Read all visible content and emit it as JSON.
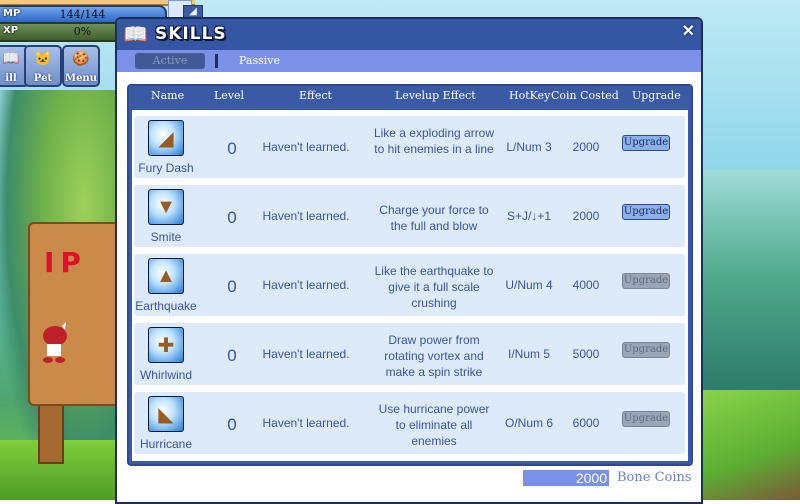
{
  "hud": {
    "mp_label": "MP",
    "mp_value": "144/144",
    "xp_label": "XP",
    "xp_value": "0%",
    "buttons": [
      {
        "label": "ill",
        "icon": "skill-book-icon"
      },
      {
        "label": "Pet",
        "icon": "pet-icon"
      },
      {
        "label": "Menu",
        "icon": "menu-cookie-icon"
      }
    ]
  },
  "scene": {
    "sign_text": "IP"
  },
  "window": {
    "title": "SKILLS",
    "close_glyph": "✕",
    "tabs": [
      {
        "label": "Active",
        "selected": true
      },
      {
        "label": "Passive",
        "selected": false
      }
    ],
    "columns": [
      "Name",
      "Level",
      "Effect",
      "Levelup Effect",
      "HotKey",
      "Coin Costed",
      "Upgrade"
    ],
    "skills": [
      {
        "name": "Fury Dash",
        "level": "0",
        "effect": "Haven't learned.",
        "levelup_effect": "Like a exploding arrow to hit enemies in a line",
        "hotkey": "L/Num 3",
        "cost": "2000",
        "upgrade_label": "Upgrade",
        "upgrade_enabled": true,
        "icon": "fury-dash-icon"
      },
      {
        "name": "Smite",
        "level": "0",
        "effect": "Haven't learned.",
        "levelup_effect": "Charge your force to the full and blow",
        "hotkey": "S+J/↓+1",
        "cost": "2000",
        "upgrade_label": "Upgrade",
        "upgrade_enabled": true,
        "icon": "smite-icon"
      },
      {
        "name": "Earthquake",
        "level": "0",
        "effect": "Haven't learned.",
        "levelup_effect": "Like the earthquake to give it a full scale crushing",
        "hotkey": "U/Num 4",
        "cost": "4000",
        "upgrade_label": "Upgrade",
        "upgrade_enabled": false,
        "icon": "earthquake-icon"
      },
      {
        "name": "Whirlwind",
        "level": "0",
        "effect": "Haven't learned.",
        "levelup_effect": "Draw power from rotating vortex and make a spin strike",
        "hotkey": "I/Num 5",
        "cost": "5000",
        "upgrade_label": "Upgrade",
        "upgrade_enabled": false,
        "icon": "whirlwind-icon"
      },
      {
        "name": "Hurricane",
        "level": "0",
        "effect": "Haven't learned.",
        "levelup_effect": "Use hurricane power to eliminate all enemies",
        "hotkey": "O/Num 6",
        "cost": "6000",
        "upgrade_label": "Upgrade",
        "upgrade_enabled": false,
        "icon": "hurricane-icon"
      }
    ],
    "coins_value": "2000",
    "coins_label": "Bone Coins"
  },
  "colors": {
    "title_bar": "#3556a3",
    "tab_bar": "#7b90e8",
    "row_bg": "#dceaf9",
    "text_blue": "#3b55a5"
  }
}
